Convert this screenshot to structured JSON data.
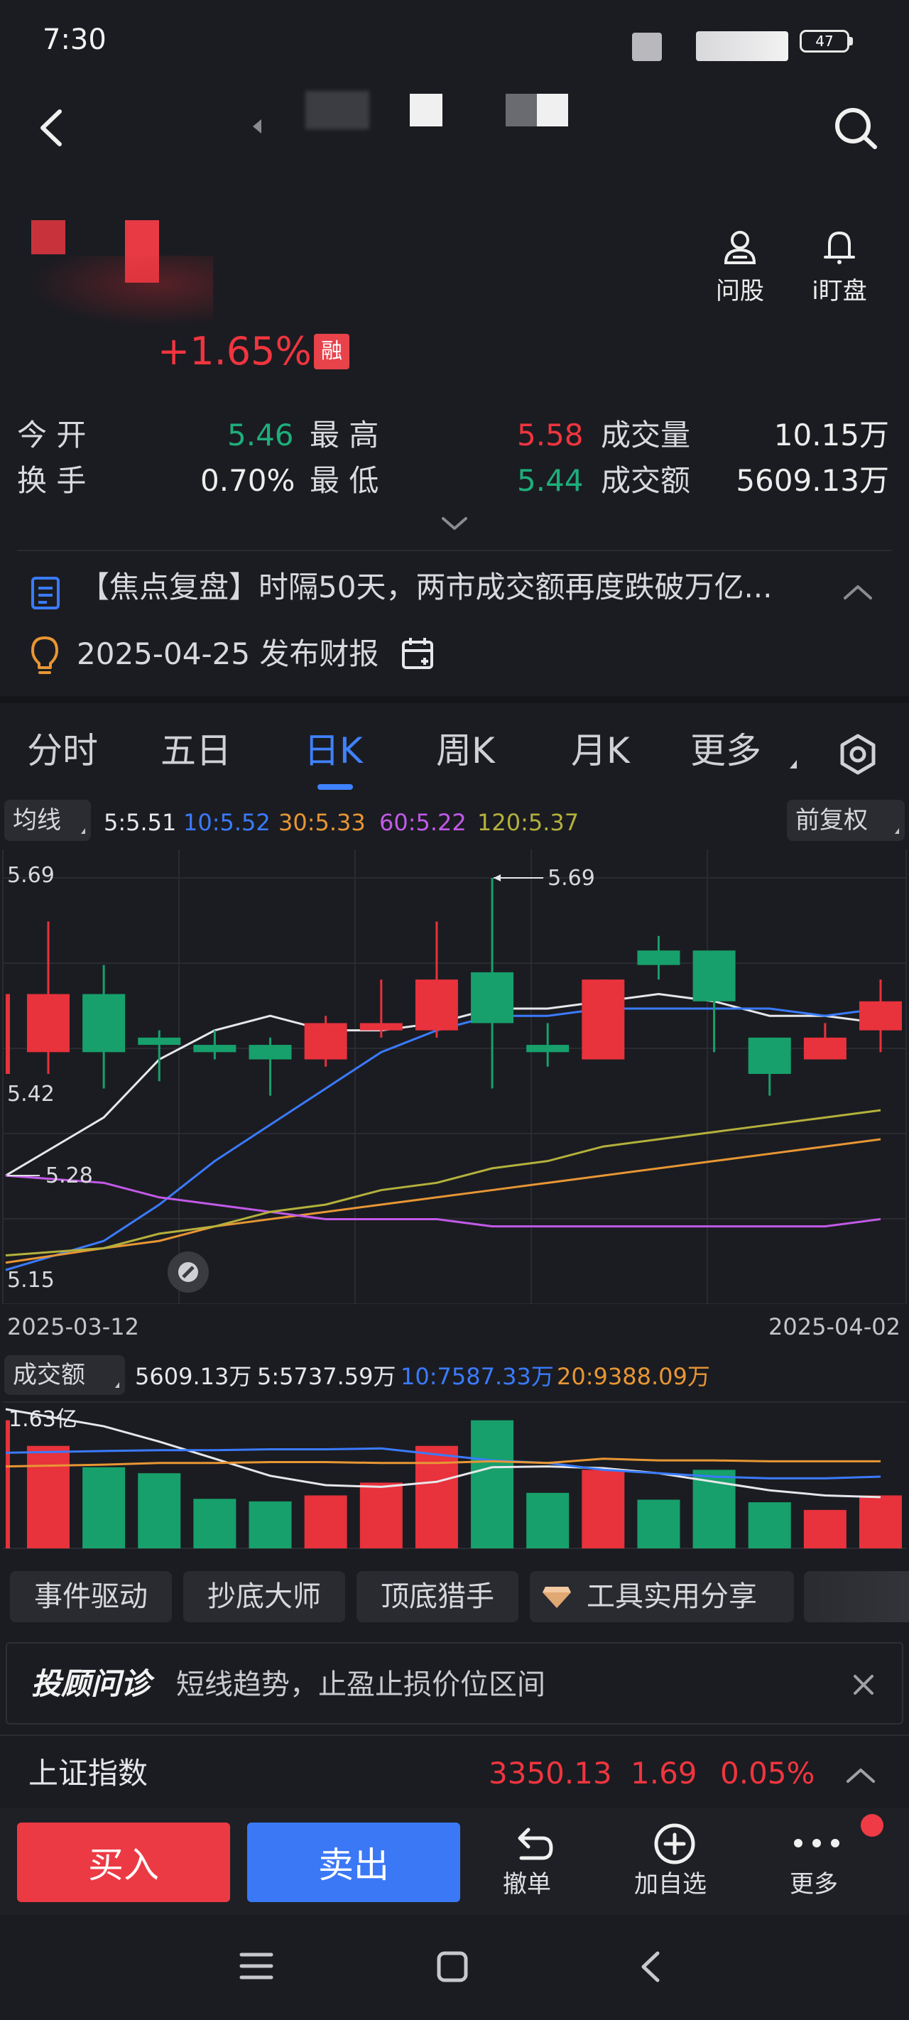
{
  "status_bar": {
    "time": "7:30",
    "battery": "47"
  },
  "quote": {
    "change_pct": "+1.65%",
    "margin_badge": "融",
    "actions": [
      {
        "label": "问股",
        "icon": "person-icon"
      },
      {
        "label": "i盯盘",
        "icon": "bell-icon"
      }
    ],
    "stats": [
      {
        "label": "今 开",
        "value": "5.46",
        "color": "#1eae7b"
      },
      {
        "label": "最 高",
        "value": "5.58",
        "color": "#f0353f"
      },
      {
        "label": "成交量",
        "value": "10.15万",
        "color": "#ededed"
      },
      {
        "label": "换 手",
        "value": "0.70%",
        "color": "#ededed"
      },
      {
        "label": "最 低",
        "value": "5.44",
        "color": "#1eae7b"
      },
      {
        "label": "成交额",
        "value": "5609.13万",
        "color": "#ededed"
      }
    ]
  },
  "news": {
    "text": "【焦点复盘】时隔50天，两市成交额再度跌破万亿..."
  },
  "report": {
    "text": "2025-04-25 发布财报"
  },
  "tabs": [
    {
      "label": "分时",
      "active": false
    },
    {
      "label": "五日",
      "active": false
    },
    {
      "label": "日K",
      "active": true
    },
    {
      "label": "周K",
      "active": false
    },
    {
      "label": "月K",
      "active": false
    },
    {
      "label": "更多",
      "active": false
    }
  ],
  "ma_bar": {
    "selector": "均线",
    "items": [
      {
        "text": "5:5.51",
        "color": "#e6e7ea"
      },
      {
        "text": "10:5.52",
        "color": "#3a7bff"
      },
      {
        "text": "30:5.33",
        "color": "#e89634"
      },
      {
        "text": "60:5.22",
        "color": "#c25ae8"
      },
      {
        "text": "120:5.37",
        "color": "#b4b13c"
      }
    ],
    "adjust": "前复权"
  },
  "chart_data": {
    "type": "candlestick",
    "price_labels": {
      "top": "5.69",
      "mid": "5.42",
      "bottom": "5.15"
    },
    "annotations": {
      "high": "5.69",
      "low": "5.28"
    },
    "ylim": [
      5.15,
      5.69
    ],
    "x_start": "2025-03-12",
    "x_end": "2025-04-02",
    "candles": [
      {
        "open": 5.45,
        "close": 5.53,
        "high": 5.63,
        "low": 5.42
      },
      {
        "open": 5.53,
        "close": 5.45,
        "high": 5.57,
        "low": 5.4
      },
      {
        "open": 5.47,
        "close": 5.46,
        "high": 5.48,
        "low": 5.41
      },
      {
        "open": 5.46,
        "close": 5.45,
        "high": 5.48,
        "low": 5.44
      },
      {
        "open": 5.46,
        "close": 5.44,
        "high": 5.47,
        "low": 5.39
      },
      {
        "open": 5.44,
        "close": 5.49,
        "high": 5.5,
        "low": 5.43
      },
      {
        "open": 5.48,
        "close": 5.49,
        "high": 5.55,
        "low": 5.47
      },
      {
        "open": 5.48,
        "close": 5.55,
        "high": 5.63,
        "low": 5.47
      },
      {
        "open": 5.56,
        "close": 5.49,
        "high": 5.69,
        "low": 5.4
      },
      {
        "open": 5.46,
        "close": 5.45,
        "high": 5.49,
        "low": 5.43
      },
      {
        "open": 5.44,
        "close": 5.55,
        "high": 5.55,
        "low": 5.44
      },
      {
        "open": 5.59,
        "close": 5.57,
        "high": 5.61,
        "low": 5.55
      },
      {
        "open": 5.59,
        "close": 5.52,
        "high": 5.59,
        "low": 5.45
      },
      {
        "open": 5.47,
        "close": 5.42,
        "high": 5.47,
        "low": 5.39
      },
      {
        "open": 5.44,
        "close": 5.47,
        "high": 5.49,
        "low": 5.44
      },
      {
        "open": 5.48,
        "close": 5.52,
        "high": 5.55,
        "low": 5.45
      }
    ],
    "ma_series": [
      {
        "name": "5",
        "color": "#e6e7ea",
        "values": [
          5.28,
          5.36,
          5.44,
          5.48,
          5.5,
          5.48,
          5.48,
          5.49,
          5.51,
          5.51,
          5.52,
          5.53,
          5.52,
          5.5,
          5.5,
          5.49
        ]
      },
      {
        "name": "10",
        "color": "#3a7bff",
        "values": [
          5.15,
          5.19,
          5.24,
          5.3,
          5.35,
          5.4,
          5.45,
          5.48,
          5.5,
          5.5,
          5.51,
          5.51,
          5.51,
          5.51,
          5.5,
          5.51
        ]
      },
      {
        "name": "30",
        "color": "#e89634",
        "values": [
          5.16,
          5.18,
          5.19,
          5.21,
          5.22,
          5.23,
          5.24,
          5.25,
          5.26,
          5.27,
          5.28,
          5.29,
          5.3,
          5.31,
          5.32,
          5.33
        ]
      },
      {
        "name": "60",
        "color": "#c25ae8",
        "values": [
          5.28,
          5.27,
          5.25,
          5.24,
          5.23,
          5.22,
          5.22,
          5.22,
          5.21,
          5.21,
          5.21,
          5.21,
          5.21,
          5.21,
          5.21,
          5.22
        ]
      },
      {
        "name": "120",
        "color": "#b4b13c",
        "values": [
          5.17,
          5.18,
          5.2,
          5.21,
          5.23,
          5.24,
          5.26,
          5.27,
          5.29,
          5.3,
          5.32,
          5.33,
          5.34,
          5.35,
          5.36,
          5.37
        ]
      }
    ],
    "volume": {
      "label": "成交额",
      "stats": [
        {
          "text": "5609.13万",
          "color": "#e6e7ea"
        },
        {
          "text": "5:5737.59万",
          "color": "#e6e7ea"
        },
        {
          "text": "10:7587.33万",
          "color": "#3a7bff"
        },
        {
          "text": "20:9388.09万",
          "color": "#e89634"
        }
      ],
      "max_label": "1.63亿",
      "ymax": 1.63,
      "bars": [
        1.2,
        0.95,
        0.88,
        0.58,
        0.55,
        0.62,
        0.77,
        1.2,
        1.5,
        0.65,
        0.92,
        0.57,
        0.92,
        0.54,
        0.45,
        0.62
      ],
      "colors": [
        "red",
        "green",
        "green",
        "green",
        "green",
        "red",
        "red",
        "red",
        "green",
        "green",
        "red",
        "green",
        "green",
        "green",
        "red",
        "red"
      ],
      "ma_series": [
        {
          "name": "5",
          "color": "#e6e7ea",
          "values": [
            1.63,
            1.43,
            1.25,
            1.05,
            0.85,
            0.74,
            0.72,
            0.78,
            0.95,
            0.96,
            0.94,
            0.88,
            0.78,
            0.68,
            0.62,
            0.6
          ]
        },
        {
          "name": "10",
          "color": "#3a7bff",
          "values": [
            1.12,
            1.14,
            1.15,
            1.15,
            1.16,
            1.16,
            1.17,
            1.1,
            1.03,
            1.0,
            0.92,
            0.88,
            0.84,
            0.82,
            0.82,
            0.84
          ]
        },
        {
          "name": "20",
          "color": "#e89634",
          "values": [
            0.96,
            0.98,
            1.0,
            1.0,
            1.01,
            1.01,
            1.0,
            1.0,
            1.02,
            1.0,
            1.05,
            1.03,
            1.03,
            1.02,
            1.02,
            1.02
          ]
        }
      ]
    }
  },
  "strategy_chips": [
    "事件驱动",
    "抄底大师",
    "顶底猎手",
    "工具实用分享"
  ],
  "advisor": {
    "brand": "投顾问诊",
    "text": "短线趋势，止盈止损价位区间"
  },
  "index": {
    "name": "上证指数",
    "value": "3350.13",
    "change": "1.69",
    "pct": "0.05%"
  },
  "bottom_bar": {
    "buy": "买入",
    "sell": "卖出",
    "actions": [
      {
        "label": "撤单",
        "icon": "undo-icon"
      },
      {
        "label": "加自选",
        "icon": "add-circle-icon"
      },
      {
        "label": "更多",
        "icon": "more-icon"
      }
    ]
  }
}
